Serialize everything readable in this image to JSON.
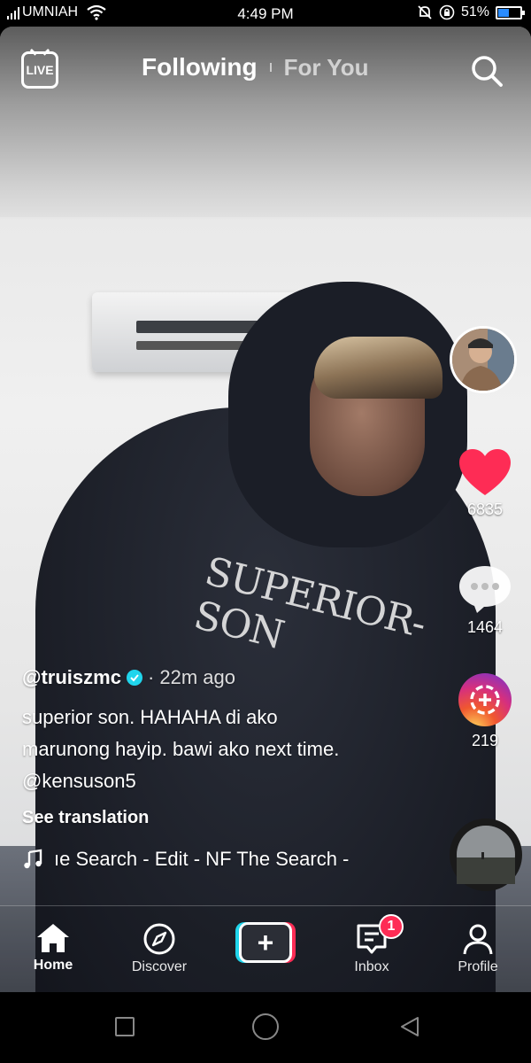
{
  "status_bar": {
    "carrier": "UMNIAH",
    "time": "4:49 PM",
    "battery": "51%",
    "battery_level": 0.51
  },
  "top_nav": {
    "live_label": "LIVE",
    "tab_following": "Following",
    "tab_for_you": "For You"
  },
  "video": {
    "shirt_print": "SUPERIOR-SON"
  },
  "rail": {
    "likes": "6835",
    "comments": "1464",
    "shares": "219"
  },
  "caption": {
    "author": "@truiszmc",
    "time_ago": "· 22m ago",
    "text_line1": "superior son. HAHAHA di ako",
    "text_line2": "marunong hayip. bawi ako next time.",
    "mention": "@kensuson5",
    "see_translation": "See translation",
    "music": "ıe Search - Edit - NF    The Search -"
  },
  "bottom_nav": {
    "home": "Home",
    "discover": "Discover",
    "inbox": "Inbox",
    "inbox_badge": "1",
    "profile": "Profile"
  },
  "colors": {
    "like": "#fe2c55",
    "verified": "#20d5ec",
    "accent_cyan": "#20d5ec",
    "accent_red": "#fe2c55"
  }
}
